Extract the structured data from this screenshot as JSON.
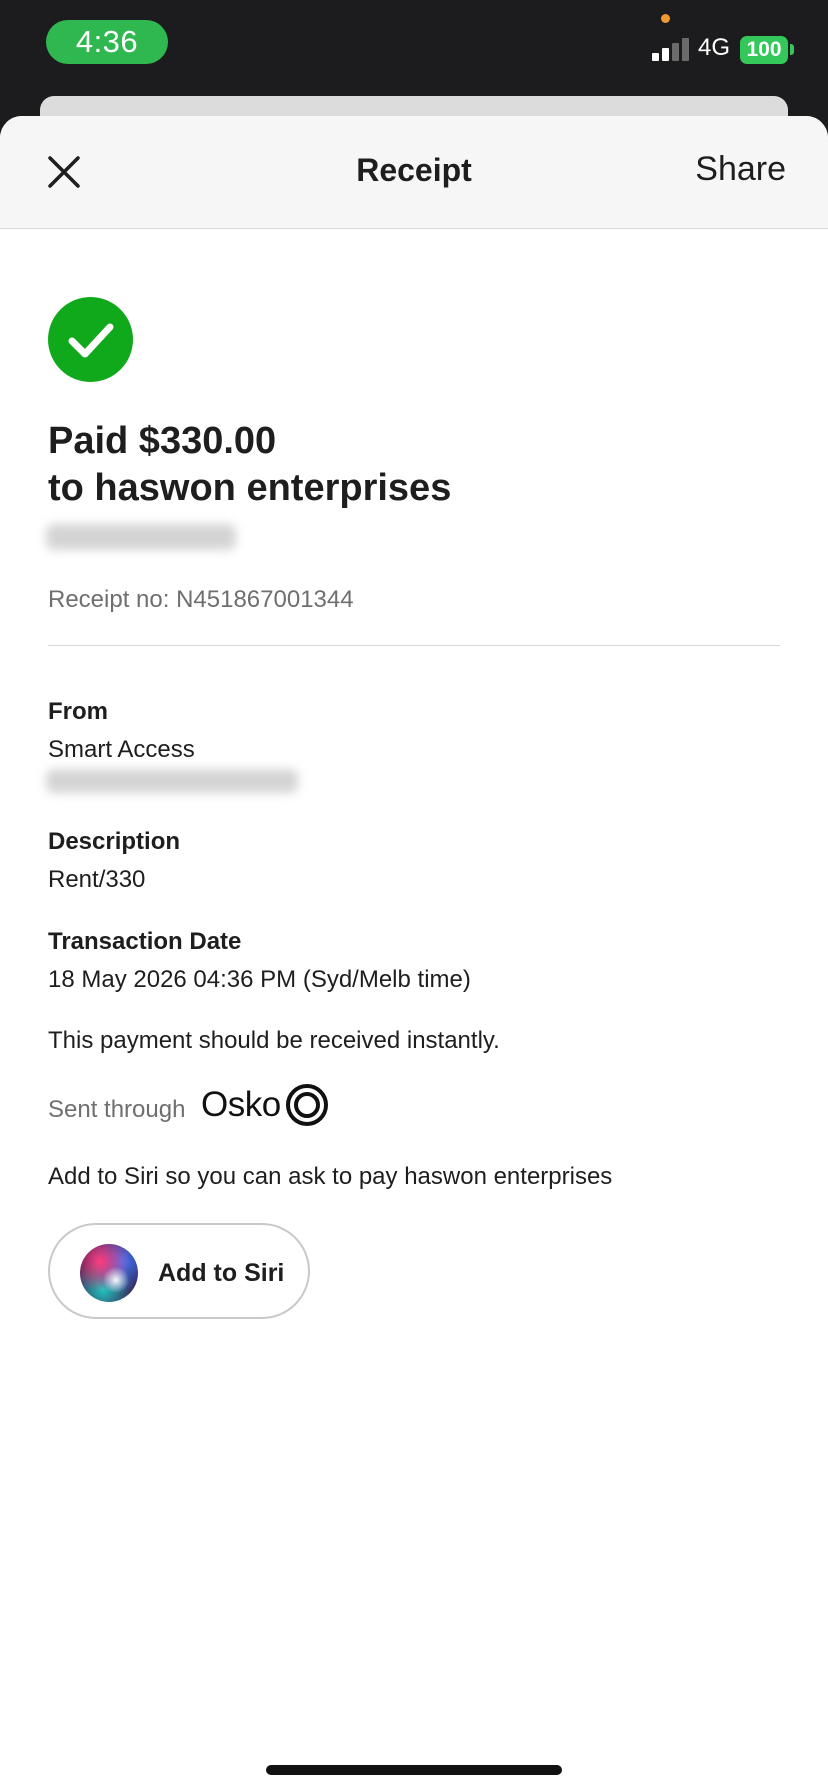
{
  "status_bar": {
    "time": "4:36",
    "network": "4G",
    "battery": "100",
    "colors": {
      "time_pill": "#2fb84f",
      "battery": "#34c759",
      "privacy_dot": "#f29a2e"
    }
  },
  "header": {
    "title": "Receipt",
    "share_label": "Share",
    "close_icon": "close-icon"
  },
  "receipt": {
    "status_icon": "checkmark-icon",
    "status_color": "#0fa91b",
    "paid_line": "Paid $330.00",
    "to_line": "to haswon enterprises",
    "receipt_no": "Receipt no: N451867001344"
  },
  "details": {
    "from_label": "From",
    "from_value": "Smart Access",
    "description_label": "Description",
    "description_value": "Rent/330",
    "date_label": "Transaction Date",
    "date_value": "18 May 2026 04:36 PM (Syd/Melb time)",
    "notice": "This payment should be received instantly.",
    "sent_through_label": "Sent through",
    "sent_through_brand": "Osko",
    "siri_prompt": "Add to Siri so you can ask to pay haswon enterprises",
    "siri_button_label": "Add to Siri"
  }
}
